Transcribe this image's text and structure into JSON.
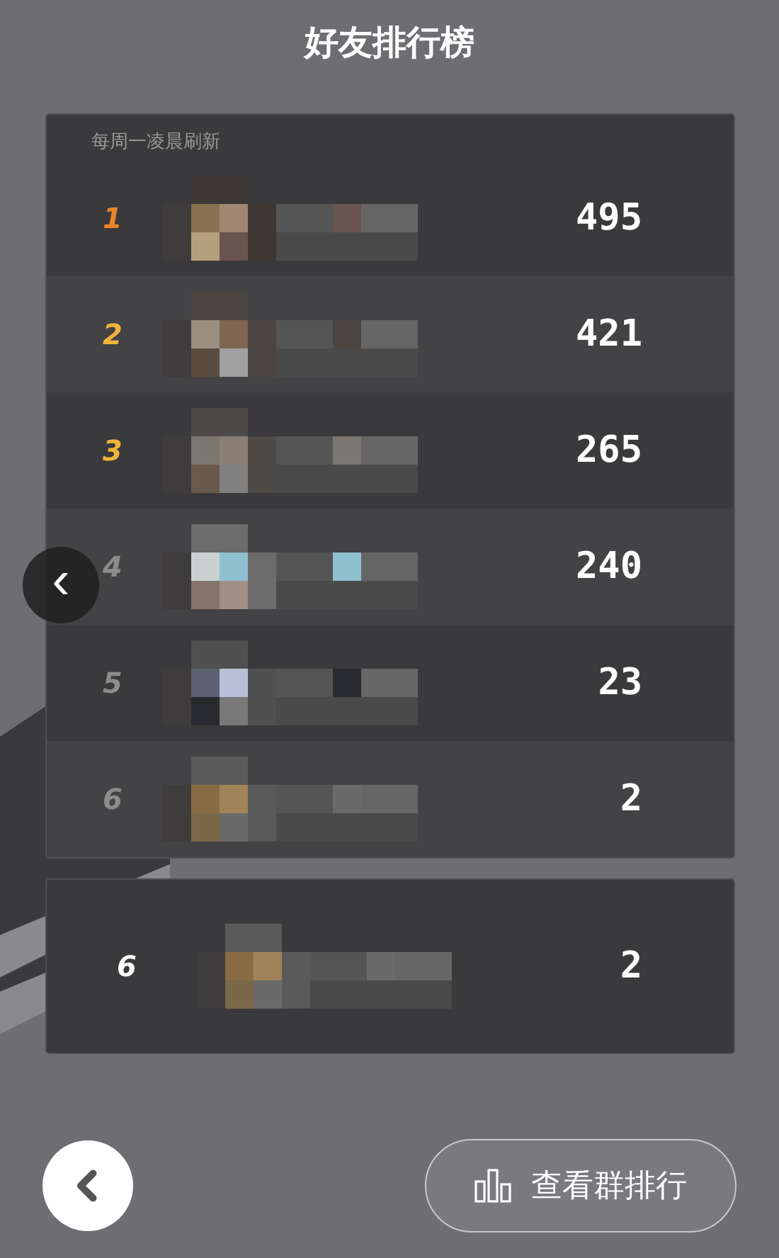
{
  "title": "好友排行榜",
  "list": {
    "note": "每周一凌晨刷新",
    "rows": [
      {
        "rank": "1",
        "color": "#e8862a",
        "score": "495"
      },
      {
        "rank": "2",
        "color": "#f0b43c",
        "score": "421"
      },
      {
        "rank": "3",
        "color": "#f0b43c",
        "score": "265"
      },
      {
        "rank": "4",
        "color": "#8c8c8c",
        "score": "240"
      },
      {
        "rank": "5",
        "color": "#8c8c8c",
        "score": "23"
      },
      {
        "rank": "6",
        "color": "#8c8c8c",
        "score": "2"
      }
    ]
  },
  "my_row": {
    "rank": "6",
    "score": "2"
  },
  "side_back": {
    "icon": "‹"
  },
  "group_button": {
    "label": "查看群排行"
  }
}
